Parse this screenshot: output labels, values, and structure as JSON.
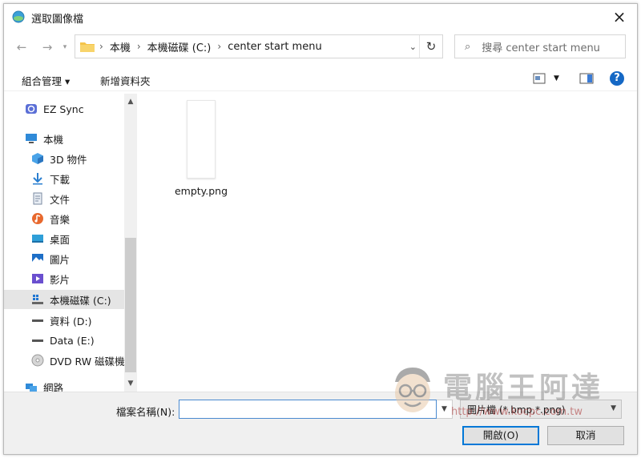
{
  "window": {
    "title": "選取圖像檔",
    "close_label": "×"
  },
  "address": {
    "crumbs": [
      "本機",
      "本機磁碟 (C:)",
      "center start menu"
    ]
  },
  "search": {
    "placeholder": "搜尋 center start menu"
  },
  "toolbar": {
    "organize_label": "組合管理 ▾",
    "new_folder_label": "新增資料夾",
    "help_label": "?"
  },
  "sidebar": {
    "items": [
      {
        "label": "EZ Sync",
        "icon": "cloud-sync-icon"
      },
      {
        "label": "本機",
        "icon": "computer-icon"
      },
      {
        "label": "3D 物件",
        "icon": "cube-3d-icon"
      },
      {
        "label": "下載",
        "icon": "download-arrow-icon"
      },
      {
        "label": "文件",
        "icon": "document-icon"
      },
      {
        "label": "音樂",
        "icon": "music-icon"
      },
      {
        "label": "桌面",
        "icon": "desktop-icon"
      },
      {
        "label": "圖片",
        "icon": "pictures-icon"
      },
      {
        "label": "影片",
        "icon": "video-icon"
      },
      {
        "label": "本機磁碟 (C:)",
        "icon": "system-drive-icon",
        "selected": true
      },
      {
        "label": "資料 (D:)",
        "icon": "drive-icon"
      },
      {
        "label": "Data (E:)",
        "icon": "drive-icon"
      },
      {
        "label": "DVD RW 磁碟機",
        "icon": "dvd-icon"
      },
      {
        "label": "網路",
        "icon": "network-icon"
      }
    ]
  },
  "files": [
    {
      "name": "empty.png",
      "icon": "image-file-icon"
    }
  ],
  "bottom": {
    "filename_label": "檔案名稱(N):",
    "filename_value": "",
    "filter_value": "圖片檔 (*.bmp,*.png)",
    "open_label": "開啟(O)",
    "cancel_label": "取消"
  },
  "watermark": {
    "text": "電腦王阿達",
    "url": "http://www.kocpc.com.tw"
  },
  "colors": {
    "accent": "#0078d7",
    "selection": "#e5e5e5",
    "folder": "#f5c44a"
  }
}
